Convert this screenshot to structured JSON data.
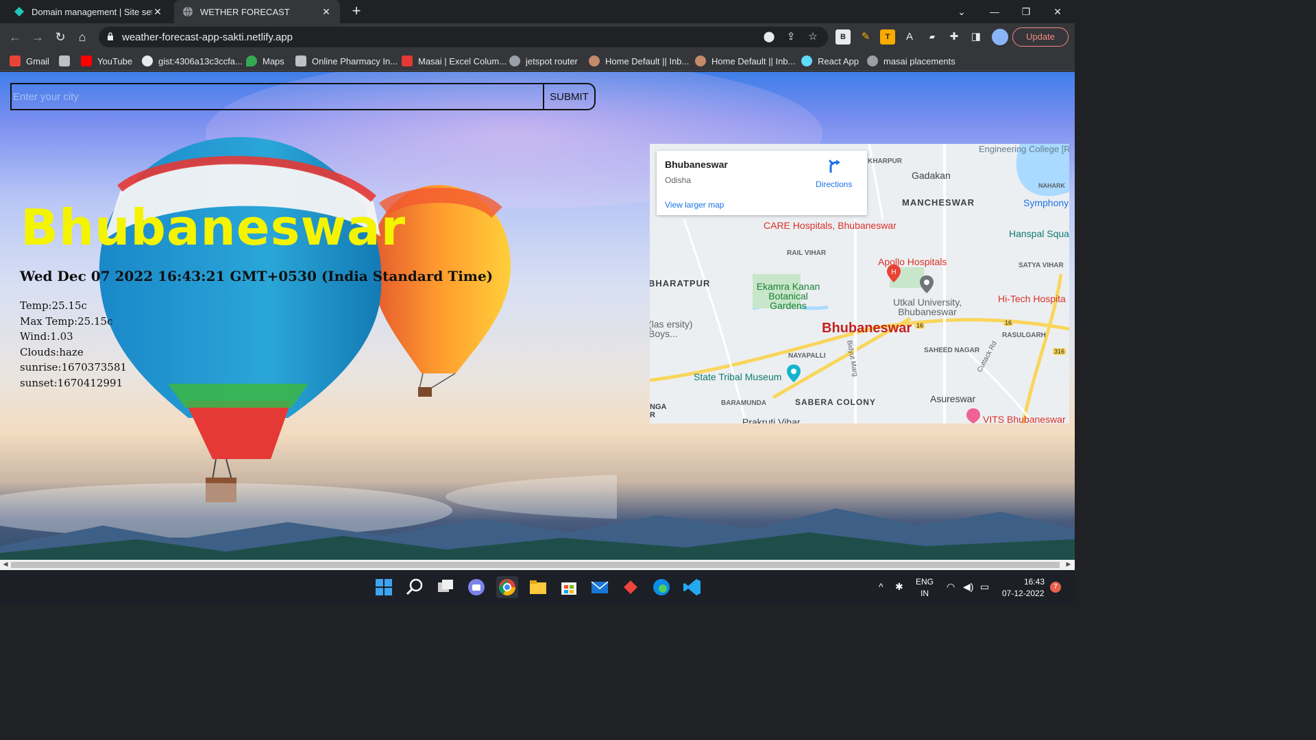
{
  "browser": {
    "tabs": [
      {
        "title": "Domain management | Site settin"
      },
      {
        "title": "WETHER FORECAST"
      }
    ],
    "url": "weather-forecast-app-sakti.netlify.app",
    "update_label": "Update",
    "bookmarks": [
      {
        "label": "Gmail"
      },
      {
        "label": ""
      },
      {
        "label": "YouTube"
      },
      {
        "label": "gist:4306a13c3ccfa..."
      },
      {
        "label": "Maps"
      },
      {
        "label": "Online Pharmacy In..."
      },
      {
        "label": "Masai | Excel Colum..."
      },
      {
        "label": "jetspot router"
      },
      {
        "label": "Home Default || Inb..."
      },
      {
        "label": "Home Default || Inb..."
      },
      {
        "label": "React App"
      },
      {
        "label": "masai placements"
      }
    ]
  },
  "search": {
    "placeholder": "Enter your city",
    "submit_label": "SUBMIT"
  },
  "weather": {
    "city": "Bhubaneswar",
    "datetime": "Wed Dec 07 2022 16:43:21 GMT+0530 (India Standard Time)",
    "stats": [
      "Temp:25.15c",
      "Max Temp:25.15c",
      "Wind:1.03",
      "Clouds:haze",
      "sunrise:1670373581",
      "sunset:1670412991"
    ]
  },
  "map": {
    "place_name": "Bhubaneswar",
    "region": "Odisha",
    "directions_label": "Directions",
    "larger_map_label": "View larger map",
    "labels": {
      "engineering_college": "Engineering College [REC], Bhubaneswar",
      "kharpur": "KHARPUR",
      "gadakan": "Gadakan",
      "naharkanta": "NAHARK",
      "mancheswar": "MANCHESWAR",
      "symphony": "Symphony",
      "hanspal": "Hanspal Squa",
      "care": "CARE Hospitals, Bhubaneswar",
      "rail_vihar": "RAIL VIHAR",
      "apollo": "Apollo Hospitals",
      "satya_vihar": "SATYA VIHAR",
      "bharatpur": "BHARATPUR",
      "ekamra": "Ekamra Kanan Botanical Gardens",
      "utkal": "Utkal University, Bhubaneswar",
      "hitech": "Hi-Tech Hospita",
      "las": "(las ersity) Boys...",
      "city_label": "Bhubaneswar",
      "rasulgarh": "RASULGARH",
      "saheed": "SAHEED NAGAR",
      "nayapalli": "NAYAPALLI",
      "bidyut": "Bidyut Marg",
      "tribal": "State Tribal Museum",
      "cuttack": "Cuttack Rd",
      "asureswar": "Asureswar",
      "baramunda": "BARAMUNDA",
      "sabera": "SABERA COLONY",
      "nga": "NGA R",
      "prakruti": "Prakruti Vihar",
      "vits": "VITS Bhubaneswar",
      "route16a": "16",
      "route16b": "16",
      "route316": "316"
    }
  },
  "taskbar": {
    "lang_top": "ENG",
    "lang_bottom": "IN",
    "time": "16:43",
    "date": "07-12-2022",
    "notif_count": "7"
  },
  "colors": {
    "city_yellow": "#f4f400",
    "chrome_dark": "#202124",
    "update_red": "#f28b82",
    "map_link_blue": "#1a73e8",
    "map_red": "#c5221f"
  }
}
